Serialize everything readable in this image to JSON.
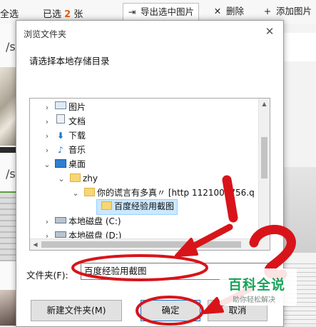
{
  "app_toolbar": {
    "select_all": "全选",
    "selected_prefix": "已选",
    "selected_count": "2",
    "selected_suffix": "张",
    "export_button": "导出选中图片",
    "delete_button": "删除",
    "add_button": "添加图片"
  },
  "left_strip": {
    "path_1": "/s",
    "path_2": "/s"
  },
  "dialog": {
    "title": "浏览文件夹",
    "close_glyph": "✕",
    "prompt": "请选择本地存储目录",
    "tree": [
      {
        "label": "图片",
        "icon": "pictures-icon",
        "chevron": "›"
      },
      {
        "label": "文档",
        "icon": "documents-icon",
        "chevron": "›"
      },
      {
        "label": "下载",
        "icon": "download-icon",
        "chevron": "›"
      },
      {
        "label": "音乐",
        "icon": "music-icon",
        "chevron": "›"
      },
      {
        "label": "桌面",
        "icon": "desktop-icon",
        "chevron": "⌄"
      },
      {
        "label": "zhy",
        "icon": "folder-icon",
        "chevron": "⌄"
      },
      {
        "label": "你的谎言有多真〃 [http   1121006756.q",
        "icon": "folder-icon",
        "chevron": "⌄"
      },
      {
        "label": "百度经验用截图",
        "icon": "folder-icon",
        "chevron": ""
      },
      {
        "label": "本地磁盘 (C:)",
        "icon": "drive-icon",
        "chevron": "›"
      },
      {
        "label": "本地磁盘 (D:)",
        "icon": "drive-icon",
        "chevron": "›"
      }
    ],
    "folder_label": "文件夹(F):",
    "folder_value": "百度经验用截图",
    "new_folder_button": "新建文件夹(M)",
    "ok_button": "确定",
    "cancel_button": "取消"
  },
  "watermark": {
    "title": "百科全说",
    "subtitle": "助你轻松解决"
  },
  "colors": {
    "annotation_red": "#d8141a",
    "selection": "#cce8ff",
    "accent": "#0078d7",
    "watermark_green": "#19a35a",
    "count_orange": "#e0620d"
  }
}
